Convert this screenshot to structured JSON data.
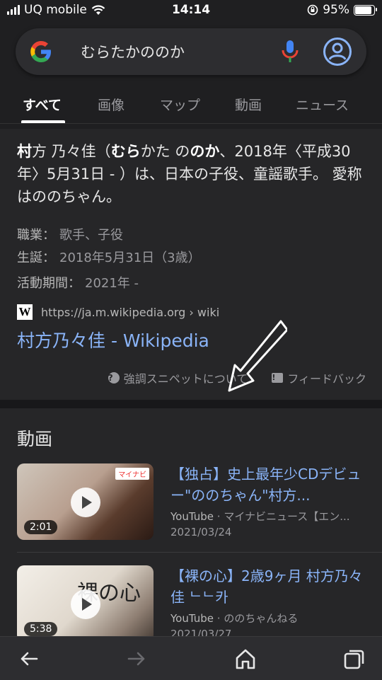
{
  "status_bar": {
    "carrier": "UQ mobile",
    "time": "14:14",
    "battery": "95%",
    "battery_level": 0.95
  },
  "search": {
    "query": "むらたかののか",
    "icons": [
      "google-logo",
      "mic-icon",
      "account-icon"
    ]
  },
  "tabs": [
    {
      "label": "すべて",
      "active": true
    },
    {
      "label": "画像",
      "active": false
    },
    {
      "label": "マップ",
      "active": false
    },
    {
      "label": "動画",
      "active": false
    },
    {
      "label": "ニュース",
      "active": false
    }
  ],
  "snippet": {
    "text_parts": [
      "村",
      "方 乃々佳（",
      "むら",
      "かた の",
      "のか",
      "、2018年〈平成30年〉5月31日 - ）は、日本の子役、童謡歌手。 愛称はののちゃん。"
    ],
    "attributes": [
      {
        "label": "職業：",
        "value": "歌手、子役"
      },
      {
        "label": "生誕：",
        "value": "2018年5月31日（3歳）"
      },
      {
        "label": "活動期間：",
        "value": "2021年 -"
      }
    ],
    "source_url": "https://ja.m.wikipedia.org › wiki",
    "source_logo": "W",
    "link_title": "村方乃々佳 - Wikipedia",
    "about_label": "強調スニペットについて",
    "feedback_label": "フィードバック"
  },
  "videos": {
    "heading": "動画",
    "items": [
      {
        "title": "【独占】史上最年少CDデビュー\"ののちゃん\"村方...",
        "source": "YouTube",
        "channel": "· マイナビニュース【エン...",
        "date": "2021/03/24",
        "duration": "2:01",
        "thumb_badge": "マイナビ",
        "thumb_text": ""
      },
      {
        "title": "【裸の心】2歳9ヶ月 村方乃々佳 ᄂᄂ카",
        "source": "YouTube",
        "channel": "· ののちゃんねる",
        "date": "2021/03/27",
        "duration": "5:38",
        "thumb_badge": "",
        "thumb_text": "裸の心"
      }
    ]
  },
  "bottom_nav": [
    "back-icon",
    "forward-icon",
    "home-icon",
    "tabs-icon"
  ],
  "colors": {
    "background": "#1f1f21",
    "card": "#262628",
    "link": "#8ab4f8",
    "muted": "#9a9a9e"
  }
}
